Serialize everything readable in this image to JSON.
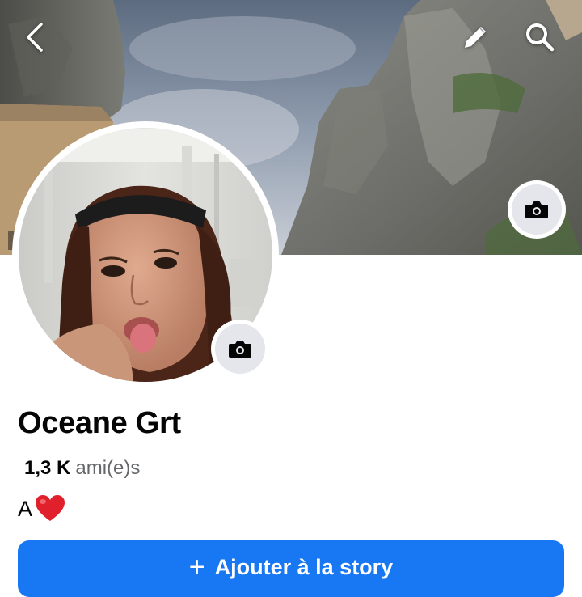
{
  "profile": {
    "name": "Oceane Grt",
    "friends_count": "1,3 K",
    "friends_label": "ami(e)s",
    "bio_text": "A",
    "bio_emoji": "heart-emoji"
  },
  "actions": {
    "add_story_plus": "+",
    "add_story_label": "Ajouter à la story"
  },
  "icons": [
    "back-arrow-icon",
    "edit-pencil-icon",
    "search-icon",
    "camera-icon"
  ],
  "colors": {
    "primary_button": "#1877f2",
    "camera_button_bg": "#e4e6eb",
    "secondary_text": "#65676b",
    "heart": "#e0202a"
  }
}
